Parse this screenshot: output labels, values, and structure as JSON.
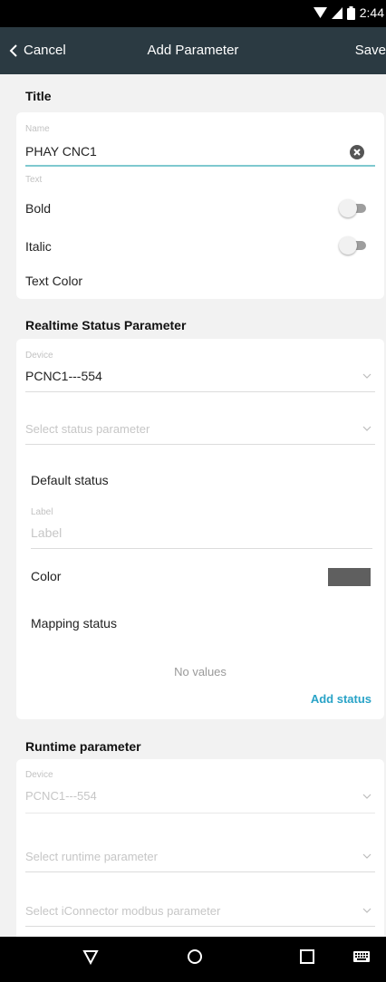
{
  "status_bar": {
    "time": "2:44"
  },
  "app_bar": {
    "cancel": "Cancel",
    "title": "Add Parameter",
    "save": "Save"
  },
  "title_section": {
    "heading": "Title",
    "name_hint": "Name",
    "name_value": "PHAY CNC1",
    "text_hint": "Text",
    "bold_label": "Bold",
    "italic_label": "Italic",
    "text_color_label": "Text Color"
  },
  "realtime_section": {
    "heading": "Realtime Status Parameter",
    "device_hint": "Device",
    "device_value": "PCNC1---554",
    "status_param_placeholder": "Select status parameter",
    "default_status": "Default status",
    "label_hint": "Label",
    "label_placeholder": "Label",
    "color_label": "Color",
    "color_swatch": "#5f5f5f",
    "mapping_status": "Mapping status",
    "no_values": "No values",
    "add_status": "Add status"
  },
  "runtime_section": {
    "heading": "Runtime parameter",
    "device_hint": "Device",
    "device_value": "PCNC1---554",
    "runtime_param_placeholder": "Select runtime parameter",
    "modbus_param_placeholder": "Select iConnector modbus parameter"
  },
  "colors": {
    "accent": "#29a3c7",
    "underline": "#7fc9cf",
    "appbar": "#2b3a42"
  }
}
